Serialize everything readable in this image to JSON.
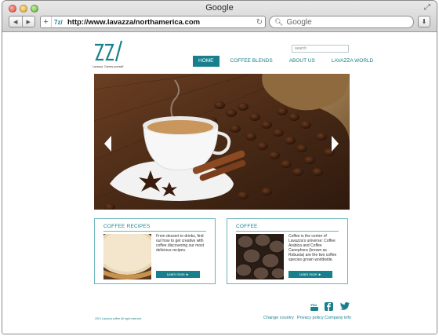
{
  "window": {
    "title": "Google"
  },
  "toolbar": {
    "url": "http://www.lavazza/northamerica.com",
    "search_placeholder": "Google",
    "back_icon": "back-arrow-icon",
    "forward_icon": "forward-arrow-icon"
  },
  "site": {
    "logo_tagline": "Lavazza. Caress yourself",
    "search_placeholder": "search",
    "menu": [
      {
        "label": "HOME",
        "active": true
      },
      {
        "label": "COFFEE BLENDS",
        "active": false
      },
      {
        "label": "ABOUT US",
        "active": false
      },
      {
        "label": "LAVAZZA WORLD",
        "active": false
      }
    ],
    "cards": [
      {
        "title": "COFFEE RECIPES",
        "text": "From dessert to drinks, find out how to get creative with coffee discovering our most delicious recipes.",
        "button": "Learn more ►"
      },
      {
        "title": "COFFEE",
        "text": "Coffee is the centre of Lavazza's universe: Coffee Arabica and Coffee Canephora (known as Robusta) are the two coffee species grown worldwide.",
        "button": "Learn more ►"
      }
    ],
    "footer": {
      "copyright": "2013 Lavazza coffee All right reserved",
      "links": [
        "Change country",
        "Privacy policy",
        "Company info"
      ]
    }
  },
  "colors": {
    "accent": "#17808c",
    "card_border": "#6bb4bd"
  }
}
